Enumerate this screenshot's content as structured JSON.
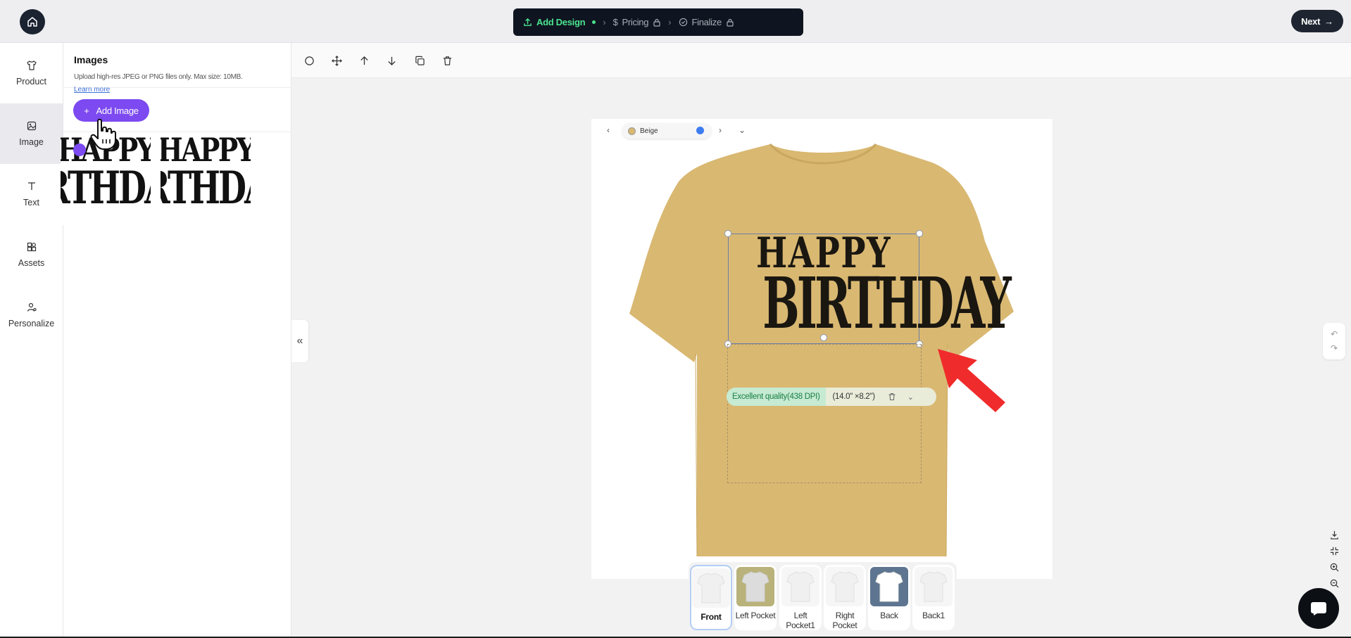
{
  "steps": [
    {
      "label": "Add Design",
      "icon": "upload-icon",
      "active": true
    },
    {
      "label": "Pricing",
      "icon": "dollar-icon",
      "locked": true
    },
    {
      "label": "Finalize",
      "icon": "check-circle-icon",
      "locked": true
    }
  ],
  "header": {
    "next_label": "Next"
  },
  "sidebar": {
    "items": [
      {
        "label": "Product",
        "icon": "shirt-icon"
      },
      {
        "label": "Image",
        "icon": "image-icon",
        "active": true
      },
      {
        "label": "Text",
        "icon": "text-icon"
      },
      {
        "label": "Assets",
        "icon": "assets-icon"
      },
      {
        "label": "Personalize",
        "icon": "personalize-icon"
      }
    ]
  },
  "panel": {
    "title": "Images",
    "description": "Upload high-res JPEG or PNG files only. Max size: 10MB.",
    "learn_more": "Learn more",
    "add_image_label": "Add Image",
    "thumbnails": [
      {
        "line1": "HAPPY",
        "line2": "RTHDA"
      },
      {
        "line1": "HAPPY",
        "line2": "RTHDA"
      }
    ]
  },
  "canvas": {
    "color_name": "Beige",
    "colors": {
      "shirt": "#d9b872",
      "accent": "#7c4af0",
      "arrow": "#f02b2b"
    },
    "design": {
      "line1": "HAPPY",
      "line2": "BIRTHDAY"
    },
    "quality_label": "Excellent quality(438 DPI)",
    "dimensions": "(14.0\" ×8.2\")"
  },
  "views": [
    {
      "label": "Front",
      "active": true
    },
    {
      "label": "Left Pocket"
    },
    {
      "label": "Left Pocket1"
    },
    {
      "label": "Right Pocket"
    },
    {
      "label": "Back"
    },
    {
      "label": "Back1"
    }
  ]
}
